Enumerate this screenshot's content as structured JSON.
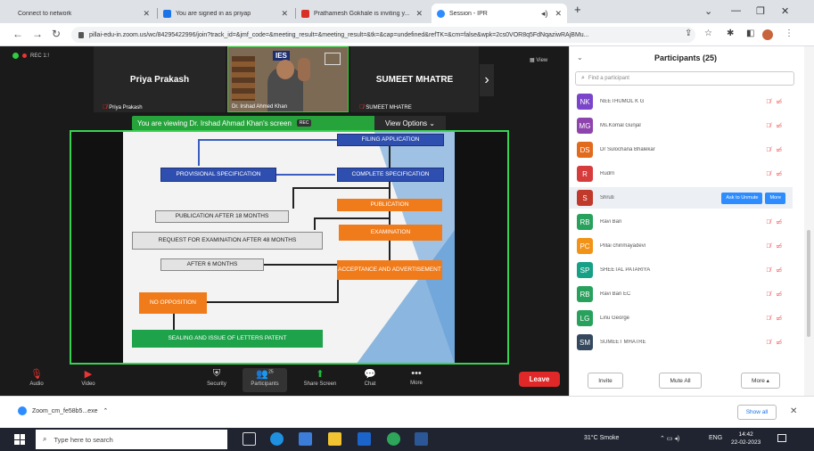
{
  "browser": {
    "tabs": [
      {
        "label": "Connect to network",
        "color": "#e8eaed"
      },
      {
        "label": "You are signed in as priyap",
        "color": "#1a73e8"
      },
      {
        "label": "Prathamesh Gokhale is inviting y...",
        "color": "#d93025"
      },
      {
        "label": "Session - IPR",
        "color": "#2d8cff"
      }
    ],
    "new_tab": "+",
    "url": "pillai-edu-in.zoom.us/wc/84295422996/join?track_id=&jmf_code=&meeting_result=&meeting_result=&tk=&cap=undefined&refTK=&cm=false&wpk=2cs0VOR8q5FdNqaziwRAjBMu..."
  },
  "meeting": {
    "recording_label": "REC 1:!",
    "view_label": "View",
    "participants_strip": [
      {
        "name": "Priya Prakash",
        "label": "Priya Prakash"
      },
      {
        "label": "Dr. Irshad Ahmed Khan",
        "logo_text": "IES"
      },
      {
        "name": "SUMEET MHATRE",
        "label": "SUMEET MHATRE"
      }
    ],
    "viewing_text": "You are viewing Dr. Irshad Ahmad Khan's screen",
    "viewing_rec": "REC",
    "view_options": "View Options"
  },
  "slide": {
    "filing_application": "FILING APPLICATION",
    "provisional_specification": "PROVISIONAL SPECIFICATION",
    "complete_specification": "COMPLETE SPECIFICATION",
    "publication": "PUBLICATION",
    "publication_after": "PUBLICATION AFTER 18 MONTHS",
    "request_examination": "REQUEST FOR EXAMINATION AFTER 48 MONTHS",
    "examination": "EXAMINATION",
    "after_6_months": "AFTER 6 MONTHS",
    "acceptance": "ACCEPTANCE AND ADVERTISEMENT",
    "no_opposition": "NO OPPOSITION",
    "sealing": "SEALING AND ISSUE OF LETTERS PATENT"
  },
  "toolbar": {
    "audio": "Audio",
    "video": "Video",
    "security": "Security",
    "participants": "Participants",
    "participants_count": "25",
    "share": "Share Screen",
    "chat": "Chat",
    "more": "More",
    "leave": "Leave"
  },
  "panel": {
    "title": "Participants (25)",
    "search_placeholder": "Find a participant",
    "participants": [
      {
        "initials": "NK",
        "name": "NEETHUMOL K G",
        "color": "#7a45c9"
      },
      {
        "initials": "MG",
        "name": "Ms.Komal Gunjal",
        "color": "#8e44ad"
      },
      {
        "initials": "DS",
        "name": "Dr Sulochana Bhalekar",
        "color": "#e26a1c"
      },
      {
        "initials": "R",
        "name": "Rudrri",
        "color": "#d63c3c"
      },
      {
        "initials": "S",
        "name": "Shruti",
        "color": "#c0392b"
      },
      {
        "initials": "RB",
        "name": "Ravi Bari",
        "color": "#27a15b"
      },
      {
        "initials": "PC",
        "name": "Pillai chinmayadevi",
        "color": "#f29318"
      },
      {
        "initials": "SP",
        "name": "SHEETAL PATARIYA",
        "color": "#16a085"
      },
      {
        "initials": "RB",
        "name": "Ravi Bari EC",
        "color": "#27a15b"
      },
      {
        "initials": "LG",
        "name": "Linu George",
        "color": "#27a15b"
      },
      {
        "initials": "SM",
        "name": "SUMEET MHATRE",
        "color": "#34495e"
      }
    ],
    "ask_unmute": "Ask to Unmute",
    "more": "More",
    "invite": "Invite",
    "mute_all": "Mute All",
    "more_footer": "More"
  },
  "downloads": {
    "file": "Zoom_cm_fe58b5...exe",
    "show_all": "Show all"
  },
  "taskbar": {
    "search": "Type here to search",
    "weather": "31°C Smoke",
    "lang": "ENG",
    "time": "14:42",
    "date": "22-02-2023"
  }
}
